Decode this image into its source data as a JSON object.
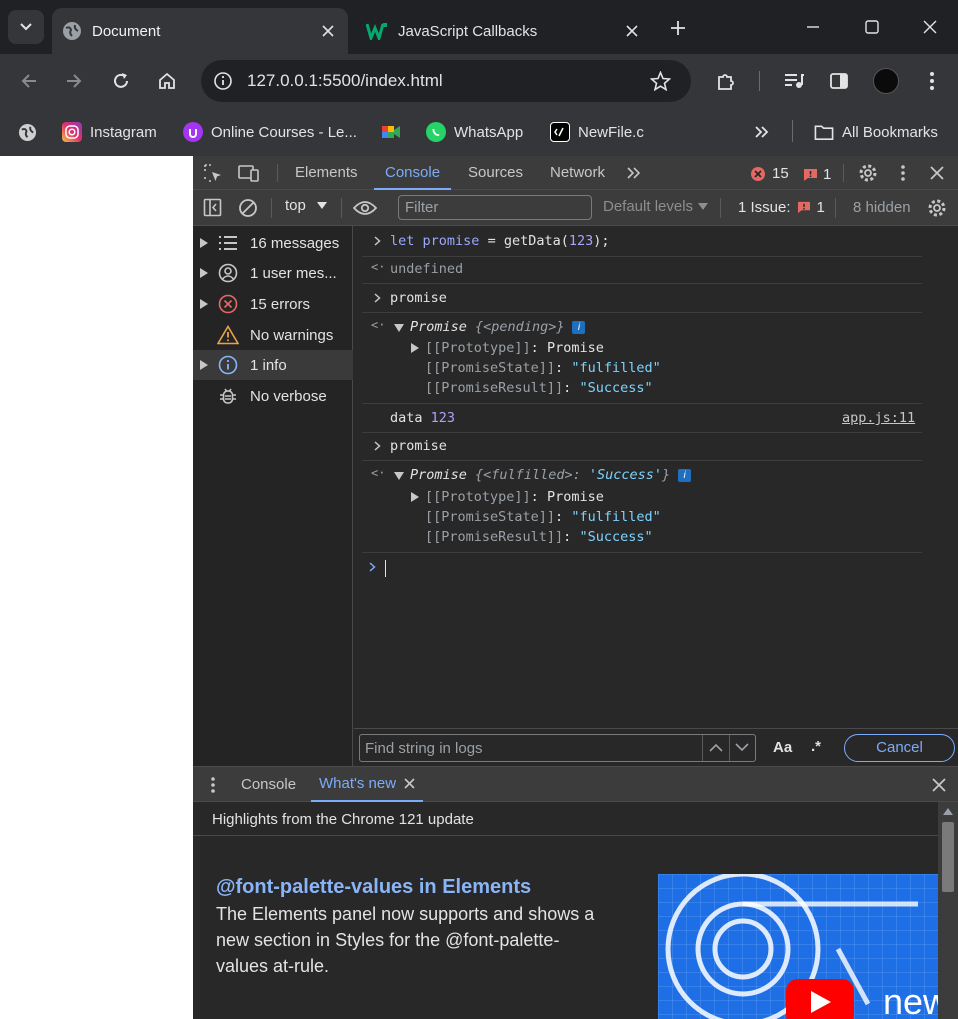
{
  "browser": {
    "tabs": [
      {
        "title": "Document",
        "active": true
      },
      {
        "title": "JavaScript Callbacks",
        "active": false
      }
    ],
    "url": "127.0.0.1:5500/index.html",
    "bookmarks": [
      {
        "label": "",
        "icon": "globe-icon"
      },
      {
        "label": "Instagram",
        "icon": "instagram-icon"
      },
      {
        "label": "Online Courses - Le...",
        "icon": "udemy-icon"
      },
      {
        "label": "",
        "icon": "google-meet-icon"
      },
      {
        "label": "WhatsApp",
        "icon": "whatsapp-icon"
      },
      {
        "label": "NewFile.c",
        "icon": "code-file-icon"
      }
    ],
    "all_bookmarks": "All Bookmarks"
  },
  "devtools": {
    "tabs": [
      "Elements",
      "Console",
      "Sources",
      "Network"
    ],
    "active_tab": "Console",
    "error_count": "15",
    "issue_count": "1",
    "context": "top",
    "filter_placeholder": "Filter",
    "levels": "Default levels",
    "issues_label": "1 Issue:",
    "issues_count": "1",
    "hidden": "8 hidden",
    "sidebar": [
      {
        "label": "16 messages",
        "icon": "list-icon"
      },
      {
        "label": "1 user mes...",
        "icon": "user-icon"
      },
      {
        "label": "15 errors",
        "icon": "error-icon"
      },
      {
        "label": "No warnings",
        "icon": "warning-icon"
      },
      {
        "label": "1 info",
        "icon": "info-icon"
      },
      {
        "label": "No verbose",
        "icon": "bug-icon"
      }
    ],
    "console": {
      "input1_kw": "let",
      "input1_var": "promise",
      "input1_rest": " = getData(",
      "input1_num": "123",
      "input1_end": ");",
      "out_undefined": "undefined",
      "input2": "promise",
      "promise1_head": "Promise",
      "promise1_state_text": "{<pending>}",
      "proto_key": "[[Prototype]]",
      "proto_val": "Promise",
      "state_key": "[[PromiseState]]",
      "state_val": "\"fulfilled\"",
      "result_key": "[[PromiseResult]]",
      "result_val": "\"Success\"",
      "log_text": "data",
      "log_num": "123",
      "log_source": "app.js:11",
      "input3": "promise",
      "promise2_head": "Promise",
      "promise2_open": "{<fulfilled>: ",
      "promise2_val": "'Success'",
      "promise2_close": "}"
    },
    "find_placeholder": "Find string in logs",
    "aa": "Aa",
    "regex": ".*",
    "cancel": "Cancel",
    "drawer_tabs": [
      "Console",
      "What's new"
    ],
    "whats_new": {
      "header": "Highlights from the Chrome 121 update",
      "title": "@font-palette-values in Elements",
      "body": "The Elements panel now supports and shows a new section in Styles for the @font-palette-values at-rule.",
      "image_text": "new"
    }
  }
}
